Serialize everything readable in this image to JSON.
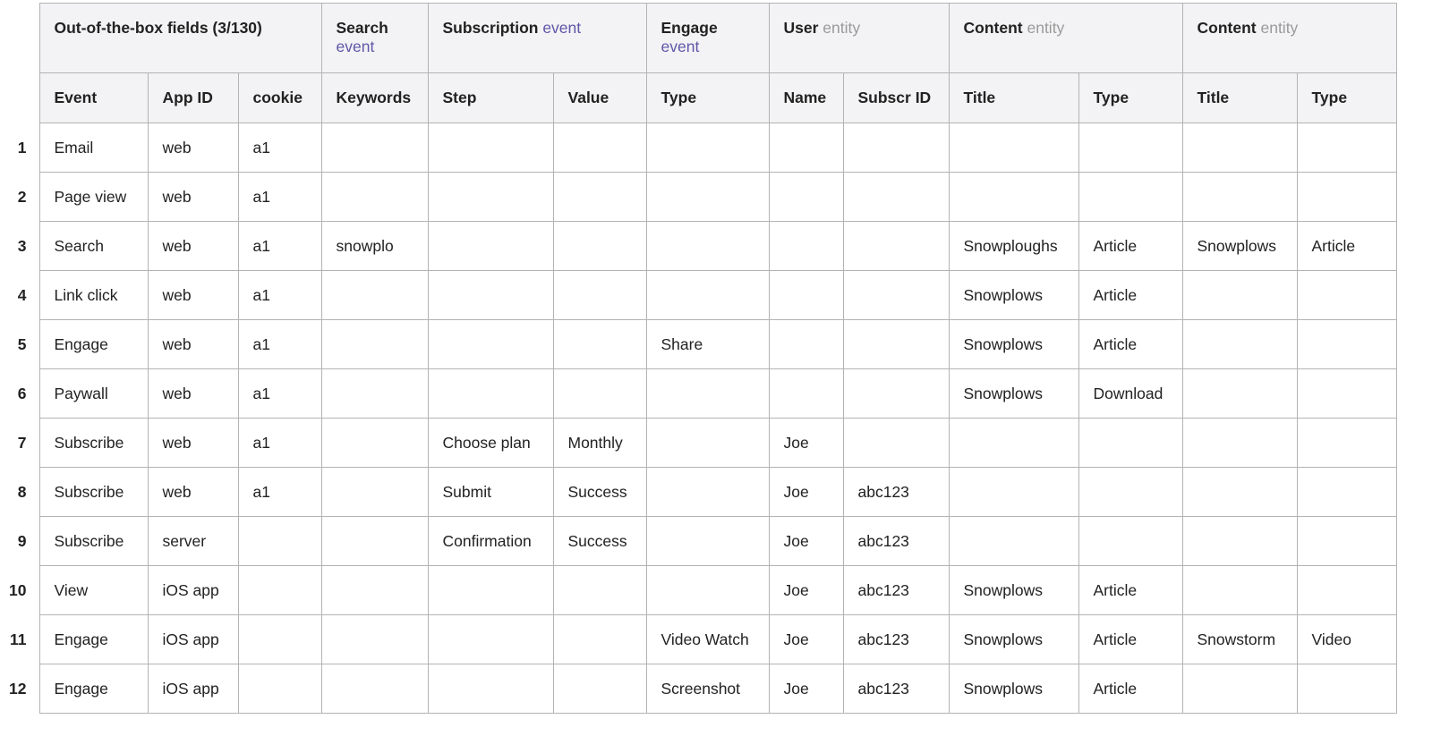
{
  "colors": {
    "header_bg": "#f3f3f5",
    "border": "#b3b3b3",
    "event_suffix": "#5f56a8",
    "entity_suffix": "#9a9a9a"
  },
  "groups": [
    {
      "label": "Out-of-the-box fields (3/130)",
      "suffix": "",
      "kind": "",
      "span": 3
    },
    {
      "label": "Search",
      "suffix": "event",
      "kind": "event",
      "span": 1,
      "break": true
    },
    {
      "label": "Subscription",
      "suffix": "event",
      "kind": "event",
      "span": 2
    },
    {
      "label": "Engage",
      "suffix": "event",
      "kind": "event",
      "span": 1,
      "break": true
    },
    {
      "label": "User",
      "suffix": "entity",
      "kind": "entity",
      "span": 2
    },
    {
      "label": "Content",
      "suffix": "entity",
      "kind": "entity",
      "span": 2
    },
    {
      "label": "Content",
      "suffix": "entity",
      "kind": "entity",
      "span": 2
    }
  ],
  "columns": [
    "Event",
    "App ID",
    "cookie",
    "Keywords",
    "Step",
    "Value",
    "Type",
    "Name",
    "Subscr ID",
    "Title",
    "Type",
    "Title",
    "Type"
  ],
  "rows": [
    {
      "n": "1",
      "cells": [
        "Email",
        "web",
        "a1",
        "",
        "",
        "",
        "",
        "",
        "",
        "",
        "",
        "",
        ""
      ]
    },
    {
      "n": "2",
      "cells": [
        "Page view",
        "web",
        "a1",
        "",
        "",
        "",
        "",
        "",
        "",
        "",
        "",
        "",
        ""
      ]
    },
    {
      "n": "3",
      "cells": [
        "Search",
        "web",
        "a1",
        "snowplo",
        "",
        "",
        "",
        "",
        "",
        "Snowploughs",
        "Article",
        "Snowplows",
        "Article"
      ]
    },
    {
      "n": "4",
      "cells": [
        "Link click",
        "web",
        "a1",
        "",
        "",
        "",
        "",
        "",
        "",
        "Snowplows",
        "Article",
        "",
        ""
      ]
    },
    {
      "n": "5",
      "cells": [
        "Engage",
        "web",
        "a1",
        "",
        "",
        "",
        "Share",
        "",
        "",
        "Snowplows",
        "Article",
        "",
        ""
      ]
    },
    {
      "n": "6",
      "cells": [
        "Paywall",
        "web",
        "a1",
        "",
        "",
        "",
        "",
        "",
        "",
        "Snowplows",
        "Download",
        "",
        ""
      ]
    },
    {
      "n": "7",
      "cells": [
        "Subscribe",
        "web",
        "a1",
        "",
        "Choose plan",
        "Monthly",
        "",
        "Joe",
        "",
        "",
        "",
        "",
        ""
      ]
    },
    {
      "n": "8",
      "cells": [
        "Subscribe",
        "web",
        "a1",
        "",
        "Submit",
        "Success",
        "",
        "Joe",
        "abc123",
        "",
        "",
        "",
        ""
      ]
    },
    {
      "n": "9",
      "cells": [
        "Subscribe",
        "server",
        "",
        "",
        "Confirmation",
        "Success",
        "",
        "Joe",
        "abc123",
        "",
        "",
        "",
        ""
      ]
    },
    {
      "n": "10",
      "cells": [
        "View",
        "iOS app",
        "",
        "",
        "",
        "",
        "",
        "Joe",
        "abc123",
        "Snowplows",
        "Article",
        "",
        ""
      ]
    },
    {
      "n": "11",
      "cells": [
        "Engage",
        "iOS app",
        "",
        "",
        "",
        "",
        "Video Watch",
        "Joe",
        "abc123",
        "Snowplows",
        "Article",
        "Snowstorm",
        "Video"
      ]
    },
    {
      "n": "12",
      "cells": [
        "Engage",
        "iOS app",
        "",
        "",
        "",
        "",
        "Screenshot",
        "Joe",
        "abc123",
        "Snowplows",
        "Article",
        "",
        ""
      ]
    }
  ]
}
